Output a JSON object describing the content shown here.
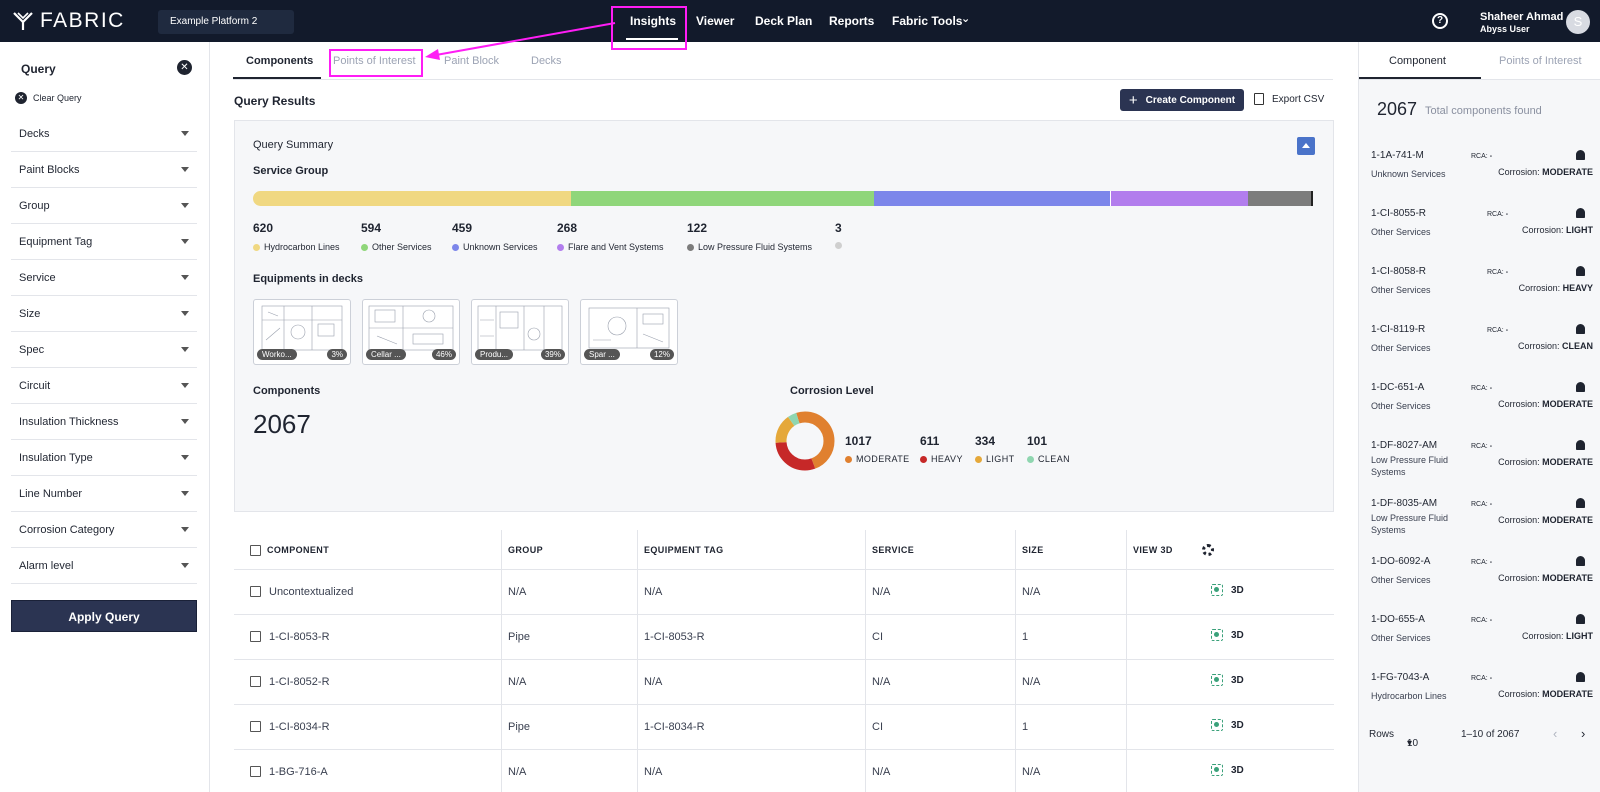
{
  "topbar": {
    "logo": "FABRIC",
    "platform": "Example Platform 2",
    "nav": [
      "Insights",
      "Viewer",
      "Deck Plan",
      "Reports",
      "Fabric Tools"
    ],
    "help": "?",
    "user_name": "Shaheer Ahmad",
    "user_role": "Abyss User",
    "avatar": "S"
  },
  "sidebar": {
    "title": "Query",
    "clear": "Clear Query",
    "filters": [
      "Decks",
      "Paint Blocks",
      "Group",
      "Equipment Tag",
      "Service",
      "Size",
      "Spec",
      "Circuit",
      "Insulation Thickness",
      "Insulation Type",
      "Line Number",
      "Corrosion Category",
      "Alarm level"
    ],
    "apply": "Apply Query"
  },
  "main": {
    "tabs": [
      "Components",
      "Points of Interest",
      "Paint Block",
      "Decks"
    ],
    "results_title": "Query Results",
    "create_label": "Create Component",
    "export_label": "Export CSV",
    "summary": {
      "title": "Query Summary",
      "service_group_title": "Service Group",
      "service_groups": [
        {
          "count": "620",
          "label": "Hydrocarbon Lines",
          "color": "#f0d882"
        },
        {
          "count": "594",
          "label": "Other Services",
          "color": "#8fd67a"
        },
        {
          "count": "459",
          "label": "Unknown Services",
          "color": "#7c86ea"
        },
        {
          "count": "268",
          "label": "Flare and Vent Systems",
          "color": "#b27ded"
        },
        {
          "count": "122",
          "label": "Low Pressure Fluid Systems",
          "color": "#7c7c7c"
        },
        {
          "count": "3",
          "label": "",
          "color": "#cfcfcf"
        }
      ],
      "equipments_title": "Equipments in decks",
      "decks": [
        {
          "name": "Worko...",
          "pct": "3%"
        },
        {
          "name": "Cellar ...",
          "pct": "46%"
        },
        {
          "name": "Produ...",
          "pct": "39%"
        },
        {
          "name": "Spar ...",
          "pct": "12%"
        }
      ],
      "components_title": "Components",
      "components_count": "2067",
      "corrosion_title": "Corrosion Level",
      "corrosion": [
        {
          "count": "1017",
          "label": "MODERATE",
          "color": "#e0802f",
          "value": 1017
        },
        {
          "count": "611",
          "label": "HEAVY",
          "color": "#c62828",
          "value": 611
        },
        {
          "count": "334",
          "label": "LIGHT",
          "color": "#e5a83a",
          "value": 334
        },
        {
          "count": "101",
          "label": "CLEAN",
          "color": "#8fd6b0",
          "value": 101
        }
      ]
    },
    "table": {
      "headers": [
        "COMPONENT",
        "GROUP",
        "EQUIPMENT TAG",
        "SERVICE",
        "SIZE",
        "VIEW 3D"
      ],
      "view3d_label": "3D",
      "rows": [
        {
          "component": "Uncontextualized",
          "group": "N/A",
          "tag": "N/A",
          "service": "N/A",
          "size": "N/A"
        },
        {
          "component": "1-CI-8053-R",
          "group": "Pipe",
          "tag": "1-CI-8053-R",
          "service": "CI",
          "size": "1"
        },
        {
          "component": "1-CI-8052-R",
          "group": "N/A",
          "tag": "N/A",
          "service": "N/A",
          "size": "N/A"
        },
        {
          "component": "1-CI-8034-R",
          "group": "Pipe",
          "tag": "1-CI-8034-R",
          "service": "CI",
          "size": "1"
        },
        {
          "component": "1-BG-716-A",
          "group": "N/A",
          "tag": "N/A",
          "service": "N/A",
          "size": "N/A"
        }
      ]
    }
  },
  "rpanel": {
    "tabs": [
      "Component",
      "Points of Interest"
    ],
    "total": "2067",
    "total_label": "Total components found",
    "rca_label": "RCA:",
    "rca_value": "-",
    "corrosion_prefix": "Corrosion:",
    "items": [
      {
        "code": "1-1A-741-M",
        "svc": "Unknown Services",
        "corr": "MODERATE"
      },
      {
        "code": "1-CI-8055-R",
        "svc": "Other Services",
        "corr": "LIGHT"
      },
      {
        "code": "1-CI-8058-R",
        "svc": "Other Services",
        "corr": "HEAVY"
      },
      {
        "code": "1-CI-8119-R",
        "svc": "Other Services",
        "corr": "CLEAN"
      },
      {
        "code": "1-DC-651-A",
        "svc": "Other Services",
        "corr": "MODERATE"
      },
      {
        "code": "1-DF-8027-AM",
        "svc": "Low Pressure Fluid Systems",
        "corr": "MODERATE"
      },
      {
        "code": "1-DF-8035-AM",
        "svc": "Low Pressure Fluid Systems",
        "corr": "MODERATE"
      },
      {
        "code": "1-DO-6092-A",
        "svc": "Other Services",
        "corr": "MODERATE"
      },
      {
        "code": "1-DO-655-A",
        "svc": "Other Services",
        "corr": "LIGHT"
      },
      {
        "code": "1-FG-7043-A",
        "svc": "Hydrocarbon Lines",
        "corr": "MODERATE"
      }
    ],
    "rows_label": "Rows",
    "rows_value": "10",
    "range": "1–10 of 2067"
  }
}
